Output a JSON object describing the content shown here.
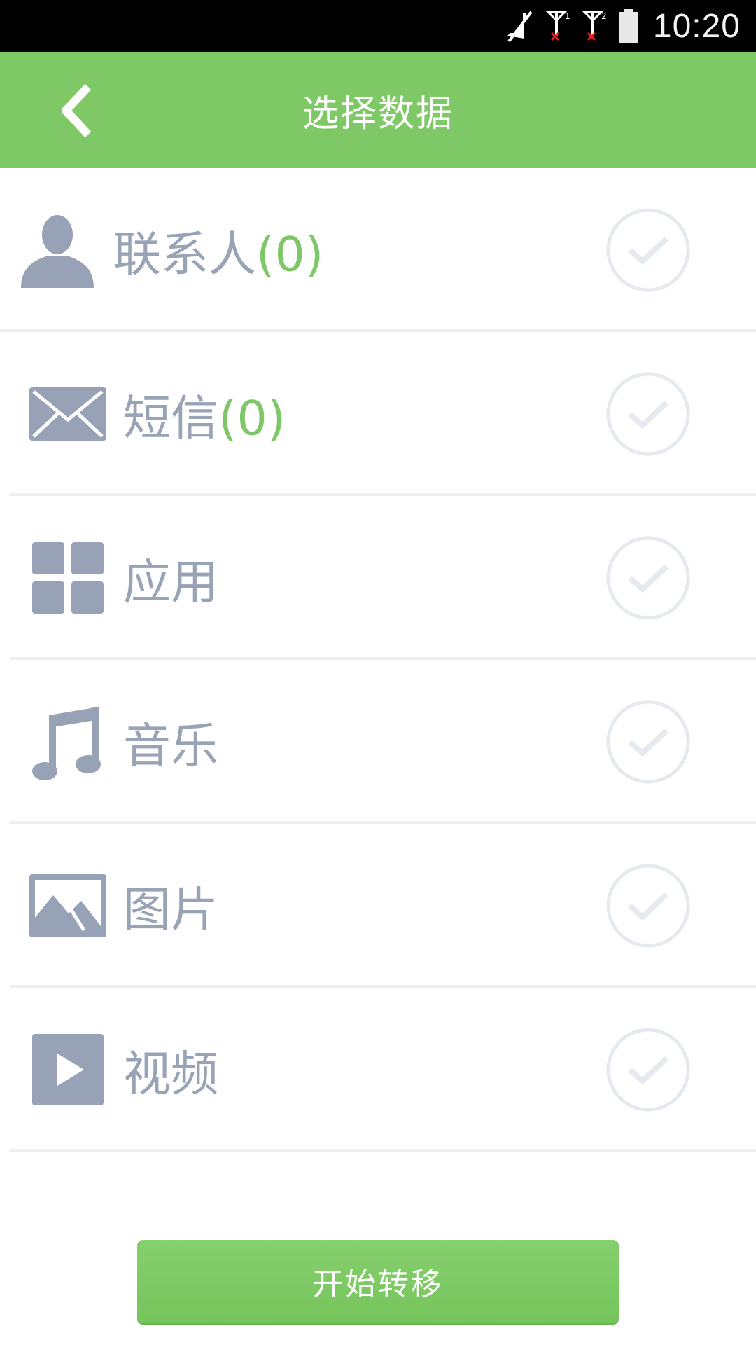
{
  "status_bar": {
    "time": "10:20",
    "icons": [
      "mute-icon",
      "sim1-signal-icon",
      "sim2-signal-icon",
      "battery-icon"
    ],
    "sim1_label": "1",
    "sim2_label": "2"
  },
  "header": {
    "title": "选择数据",
    "back_icon": "chevron-left-icon",
    "background": "#7ec865"
  },
  "items": [
    {
      "label": "联系人",
      "count": "(0)",
      "icon": "contact-icon",
      "selected": false
    },
    {
      "label": "短信",
      "count": "(0)",
      "icon": "message-icon",
      "selected": false
    },
    {
      "label": "应用",
      "count": "",
      "icon": "apps-grid-icon",
      "selected": false
    },
    {
      "label": "音乐",
      "count": "",
      "icon": "music-note-icon",
      "selected": false
    },
    {
      "label": "图片",
      "count": "",
      "icon": "picture-icon",
      "selected": false
    },
    {
      "label": "视频",
      "count": "",
      "icon": "video-play-icon",
      "selected": false
    }
  ],
  "button": {
    "label": "开始转移",
    "color": "#7ec865"
  },
  "colors": {
    "label": "#98a3b5",
    "count": "#7dc766",
    "icon": "#97a2b6",
    "check": "#e6eaef"
  }
}
